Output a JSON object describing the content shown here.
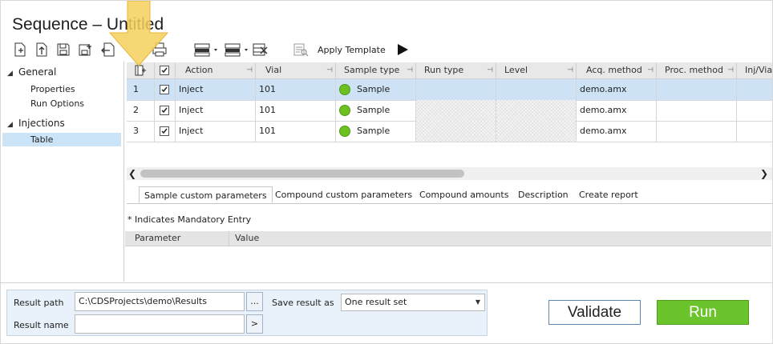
{
  "window": {
    "title": "Sequence – Untitled"
  },
  "toolbar": {
    "apply_template_label": "Apply Template",
    "buttons": [
      "add-icon",
      "import-icon",
      "save-icon",
      "save-as-icon",
      "export-icon",
      "print-icon",
      "insert-row-icon",
      "delete-row-icon",
      "clear-icon",
      "template-icon",
      "run-icon"
    ]
  },
  "nav": {
    "groups": [
      {
        "label": "General",
        "items": [
          "Properties",
          "Run Options"
        ]
      },
      {
        "label": "Injections",
        "items": [
          "Table"
        ]
      }
    ],
    "selected": "Table"
  },
  "grid": {
    "columns": [
      "Action",
      "Vial",
      "Sample type",
      "Run type",
      "Level",
      "Acq. method",
      "Proc. method",
      "Inj/Via"
    ],
    "rows": [
      {
        "num": "1",
        "checked": true,
        "action": "Inject",
        "vial": "101",
        "sample_type": "Sample",
        "run_type": "",
        "level": "",
        "acq_method": "demo.amx",
        "proc_method": "",
        "selected": true
      },
      {
        "num": "2",
        "checked": true,
        "action": "Inject",
        "vial": "101",
        "sample_type": "Sample",
        "run_type": "",
        "level": "",
        "acq_method": "demo.amx",
        "proc_method": "",
        "selected": false
      },
      {
        "num": "3",
        "checked": true,
        "action": "Inject",
        "vial": "101",
        "sample_type": "Sample",
        "run_type": "",
        "level": "",
        "acq_method": "demo.amx",
        "proc_method": "",
        "selected": false
      }
    ]
  },
  "tabs": {
    "items": [
      "Sample custom parameters",
      "Compound custom parameters",
      "Compound amounts",
      "Description",
      "Create report"
    ],
    "active": "Sample custom parameters"
  },
  "params": {
    "mandatory_note": "* Indicates Mandatory Entry",
    "headers": [
      "Parameter",
      "Value"
    ]
  },
  "result": {
    "path_label": "Result path",
    "path_value": "C:\\CDSProjects\\demo\\Results",
    "browse_label": "...",
    "name_label": "Result name",
    "name_value": "",
    "name_button_label": ">",
    "save_as_label": "Save result as",
    "save_as_value": "One result set"
  },
  "actions": {
    "validate_label": "Validate",
    "run_label": "Run"
  },
  "colors": {
    "accent_green": "#6cc42c",
    "selection_blue": "#cde3f5",
    "arrow_yellow": "#f6d05a"
  }
}
